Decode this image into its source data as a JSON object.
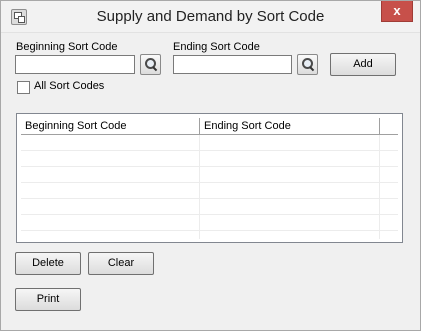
{
  "window": {
    "title": "Supply and Demand by Sort Code",
    "close_glyph": "x"
  },
  "form": {
    "beginning_label": "Beginning Sort Code",
    "beginning_value": "",
    "ending_label": "Ending Sort Code",
    "ending_value": "",
    "add_label": "Add",
    "all_codes_label": "All Sort Codes",
    "all_codes_checked": false
  },
  "grid": {
    "columns": [
      "Beginning Sort Code",
      "Ending Sort Code",
      ""
    ],
    "rows": [
      [
        "",
        ""
      ],
      [
        "",
        ""
      ],
      [
        "",
        ""
      ],
      [
        "",
        ""
      ],
      [
        "",
        ""
      ],
      [
        "",
        ""
      ],
      [
        "",
        ""
      ]
    ]
  },
  "actions": {
    "delete_label": "Delete",
    "clear_label": "Clear",
    "print_label": "Print"
  },
  "icons": {
    "app": "app-window-icon",
    "lookup": "magnifier-icon",
    "close": "close-icon"
  }
}
